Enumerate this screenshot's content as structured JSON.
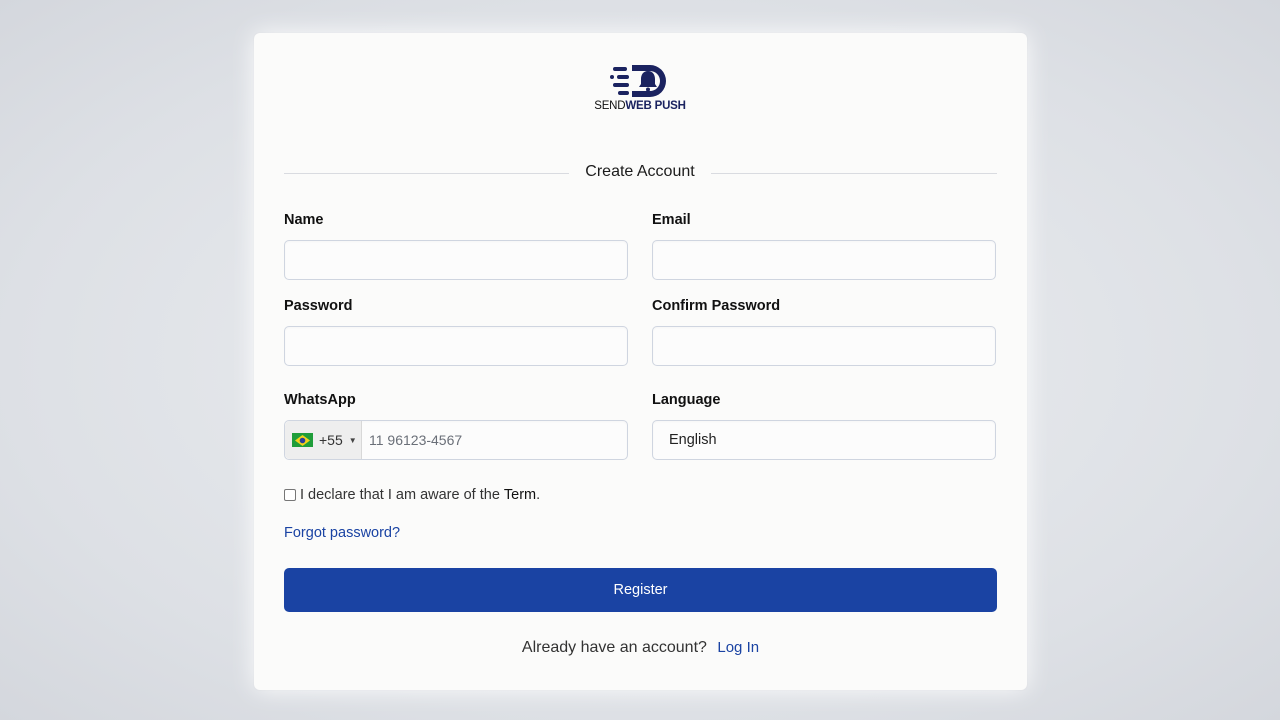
{
  "brand": {
    "name_light": "SEND",
    "name_bold": "WEB PUSH",
    "primary_color": "#1a43a3",
    "logo_color": "#1b2360",
    "logo_icon": "bell-icon"
  },
  "form": {
    "title": "Create Account",
    "name": {
      "label": "Name",
      "value": ""
    },
    "email": {
      "label": "Email",
      "value": ""
    },
    "password": {
      "label": "Password",
      "value": ""
    },
    "confirm_password": {
      "label": "Confirm Password",
      "value": ""
    },
    "whatsapp": {
      "label": "WhatsApp",
      "country_flag": "brazil-flag-icon",
      "dial_code": "+55",
      "placeholder": "11 96123-4567"
    },
    "language": {
      "label": "Language",
      "value": "English"
    },
    "terms": {
      "checked": false,
      "text": "I declare that I am aware of the",
      "link": "Term",
      "suffix": "."
    },
    "forgot_password": "Forgot password?",
    "submit": "Register"
  },
  "footer": {
    "prompt": "Already have an account?",
    "login": "Log In"
  }
}
